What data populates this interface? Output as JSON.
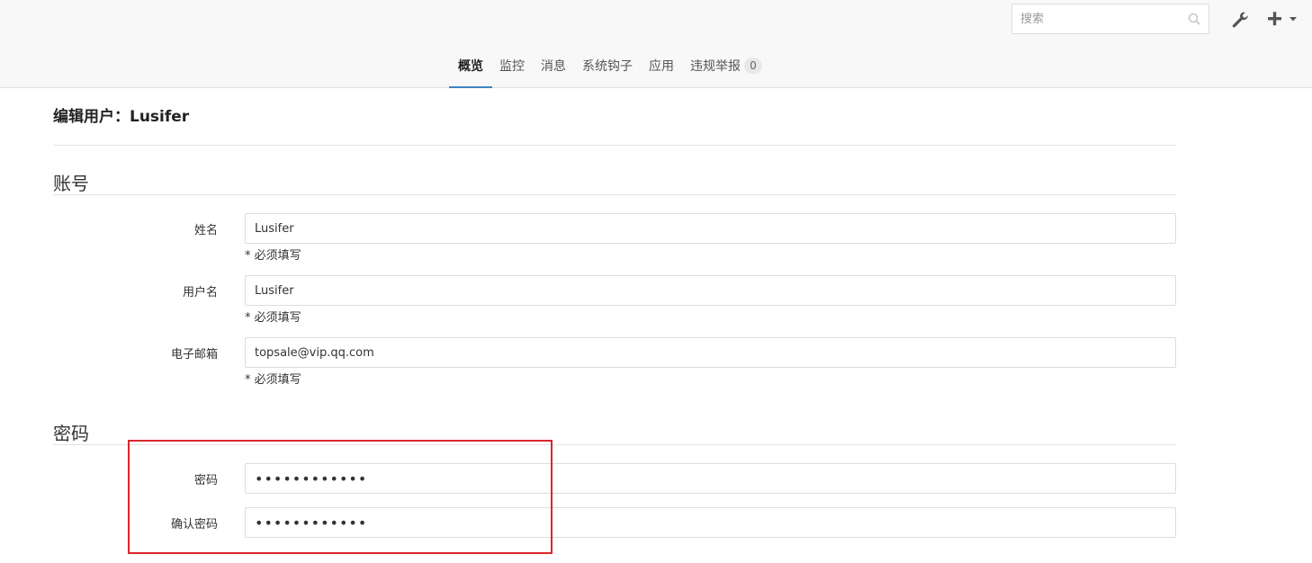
{
  "search": {
    "placeholder": "搜索"
  },
  "toolbar": {
    "settings_icon": "wrench-icon",
    "add_icon": "plus-icon"
  },
  "tabs": [
    {
      "label": "概览",
      "active": true
    },
    {
      "label": "监控"
    },
    {
      "label": "消息"
    },
    {
      "label": "系统钩子"
    },
    {
      "label": "应用"
    },
    {
      "label": "违规举报",
      "badge": "0"
    }
  ],
  "page": {
    "title": "编辑用户：Lusifer"
  },
  "account": {
    "section_title": "账号",
    "name_label": "姓名",
    "name_value": "Lusifer",
    "username_label": "用户名",
    "username_value": "Lusifer",
    "email_label": "电子邮箱",
    "email_value": "topsale@vip.qq.com",
    "required_hint": "* 必须填写"
  },
  "password": {
    "section_title": "密码",
    "password_label": "密码",
    "password_value": "••••••••••••",
    "confirm_label": "确认密码",
    "confirm_value": "••••••••••••"
  },
  "colors": {
    "accent": "#4183c4",
    "highlight_border": "#d9262d"
  }
}
